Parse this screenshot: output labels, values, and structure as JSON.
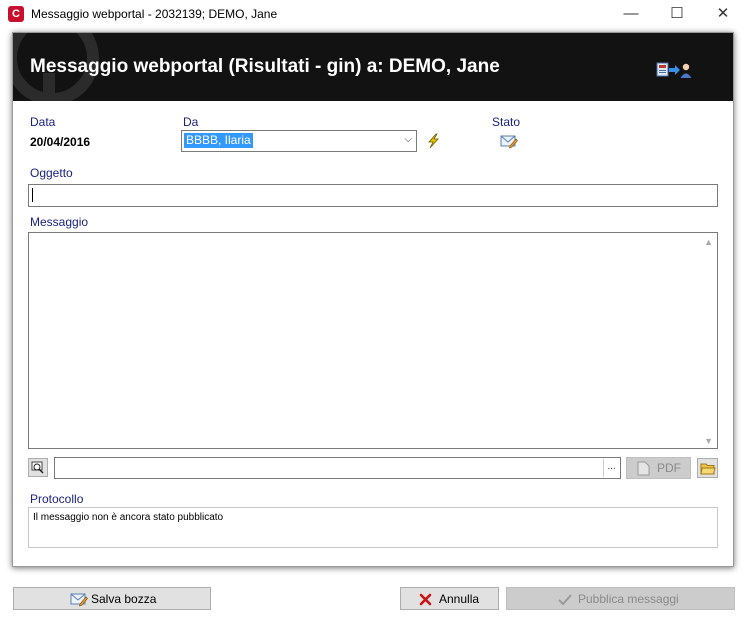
{
  "window": {
    "title": "Messaggio webportal - 2032139; DEMO, Jane",
    "app_icon": "cgm-app-icon",
    "minimize_glyph": "—",
    "maximize_glyph": "☐",
    "close_glyph": "✕"
  },
  "header": {
    "title": "Messaggio webportal (Risultati - gin) a: DEMO, Jane",
    "background": "#121212"
  },
  "fields": {
    "data_label": "Data",
    "data_value": "20/04/2016",
    "da_label": "Da",
    "da_value": "BBBB, Ilaria",
    "stato_label": "Stato",
    "oggetto_label": "Oggetto",
    "oggetto_value": "",
    "messaggio_label": "Messaggio",
    "messaggio_value": "",
    "attachment_value": "",
    "browse_label": "...",
    "pdf_label": "PDF",
    "protocollo_label": "Protocollo",
    "protocollo_text": "Il messaggio non è ancora stato pubblicato"
  },
  "buttons": {
    "save_draft": "Salva bozza",
    "cancel": "Annulla",
    "publish": "Pubblica messaggi"
  },
  "colors": {
    "label": "#1a237e",
    "selection": "#3399ff",
    "cancel_icon": "#cc1111"
  }
}
